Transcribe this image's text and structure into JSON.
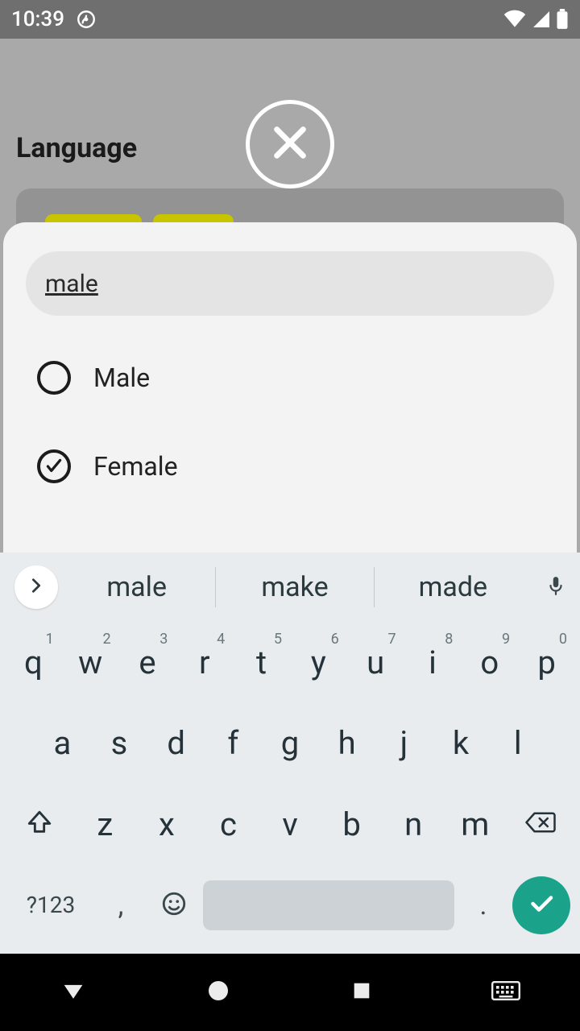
{
  "status": {
    "time": "10:39"
  },
  "bg": {
    "title": "Language"
  },
  "search": {
    "value": "male"
  },
  "options": {
    "items": [
      {
        "label": "Male",
        "checked": false
      },
      {
        "label": "Female",
        "checked": true
      }
    ]
  },
  "suggestions": {
    "items": [
      "male",
      "make",
      "made"
    ]
  },
  "keyboard": {
    "row1": [
      {
        "c": "q",
        "n": "1"
      },
      {
        "c": "w",
        "n": "2"
      },
      {
        "c": "e",
        "n": "3"
      },
      {
        "c": "r",
        "n": "4"
      },
      {
        "c": "t",
        "n": "5"
      },
      {
        "c": "y",
        "n": "6"
      },
      {
        "c": "u",
        "n": "7"
      },
      {
        "c": "i",
        "n": "8"
      },
      {
        "c": "o",
        "n": "9"
      },
      {
        "c": "p",
        "n": "0"
      }
    ],
    "row2": [
      "a",
      "s",
      "d",
      "f",
      "g",
      "h",
      "j",
      "k",
      "l"
    ],
    "row3": [
      "z",
      "x",
      "c",
      "v",
      "b",
      "n",
      "m"
    ],
    "sym": "?123",
    "comma": ",",
    "dot": "."
  }
}
